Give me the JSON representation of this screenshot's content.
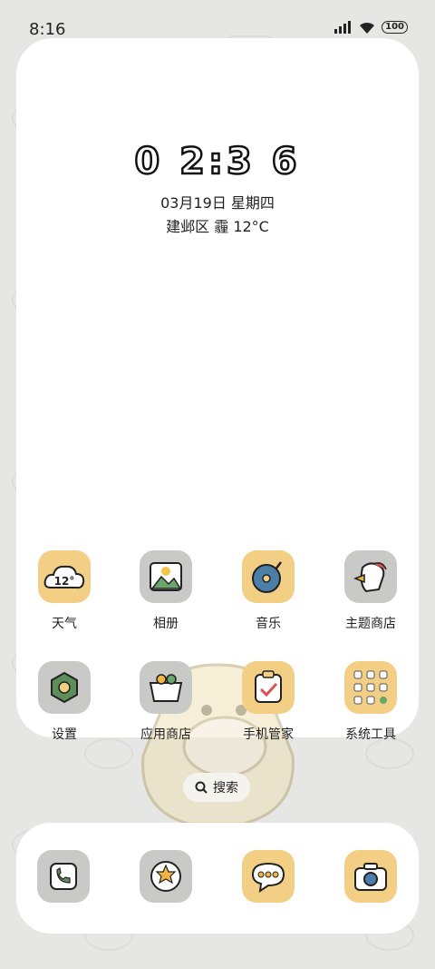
{
  "status_bar": {
    "time": "8:16",
    "battery": "100"
  },
  "widget": {
    "clock": "0 2:3 6",
    "date": "03月19日 星期四",
    "weather": "建邺区 霾 12°C"
  },
  "apps_row1": [
    {
      "label": "天气",
      "icon": "weather-cloud-icon",
      "badge": "12°"
    },
    {
      "label": "相册",
      "icon": "gallery-picture-icon"
    },
    {
      "label": "音乐",
      "icon": "music-record-icon"
    },
    {
      "label": "主题商店",
      "icon": "theme-store-duck-icon"
    }
  ],
  "apps_row2": [
    {
      "label": "设置",
      "icon": "settings-leaf-icon"
    },
    {
      "label": "应用商店",
      "icon": "app-store-basket-icon"
    },
    {
      "label": "手机管家",
      "icon": "phone-manager-clipboard-icon"
    },
    {
      "label": "系统工具",
      "icon": "system-tools-folder-icon"
    }
  ],
  "search": {
    "label": "搜索"
  },
  "dock": [
    {
      "icon": "phone-icon"
    },
    {
      "icon": "browser-globe-icon"
    },
    {
      "icon": "messages-bubble-icon"
    },
    {
      "icon": "camera-icon"
    }
  ],
  "colors": {
    "background": "#e6e6e4",
    "icon_gray": "#c9c9c7",
    "icon_yellow": "#f2cf84"
  }
}
